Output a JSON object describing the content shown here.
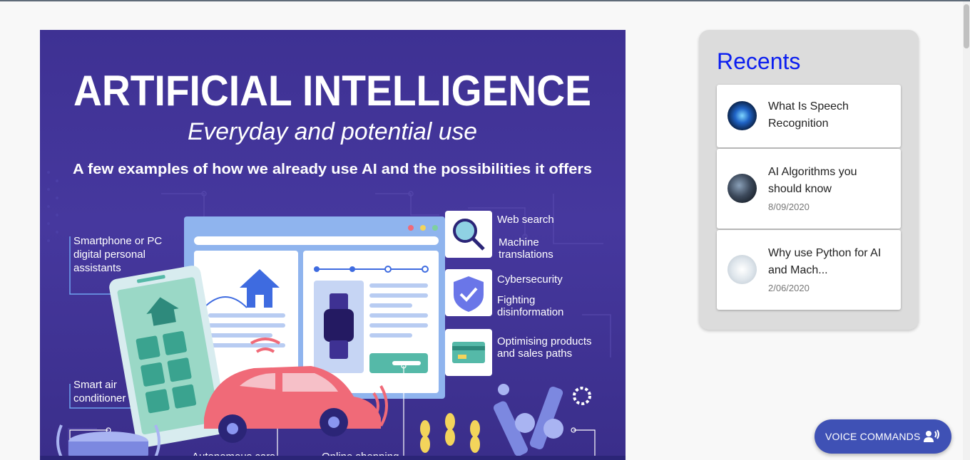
{
  "infographic": {
    "title": "ARTIFICIAL INTELLIGENCE",
    "subtitle": "Everyday and potential use",
    "tagline": "A few examples of how we already use AI and the possibilities it offers",
    "labels": {
      "assistants_1": "Smartphone or PC",
      "assistants_2": "digital personal",
      "assistants_3": "assistants",
      "web_search": "Web search",
      "machine_1": "Machine",
      "machine_2": "translations",
      "cyber": "Cybersecurity",
      "fighting_1": "Fighting",
      "fighting_2": "disinformation",
      "optimising_1": "Optimising products",
      "optimising_2": "and sales paths",
      "smart_air_1": "Smart air",
      "smart_air_2": "conditioner",
      "autonomous": "Autonomous cars",
      "online": "Online shopping"
    }
  },
  "recents": {
    "heading": "Recents",
    "items": [
      {
        "title": "What Is Speech Recognition",
        "date": ""
      },
      {
        "title": "AI Algorithms you should know",
        "date": "8/09/2020"
      },
      {
        "title": "Why use Python for AI and Mach...",
        "date": "2/06/2020"
      }
    ]
  },
  "voice_button": {
    "label": "VOICE COMMANDS"
  },
  "colors": {
    "accent": "#3f51b5",
    "recents_heading": "#0b1ef0",
    "hero_bg": "#3e3193"
  }
}
